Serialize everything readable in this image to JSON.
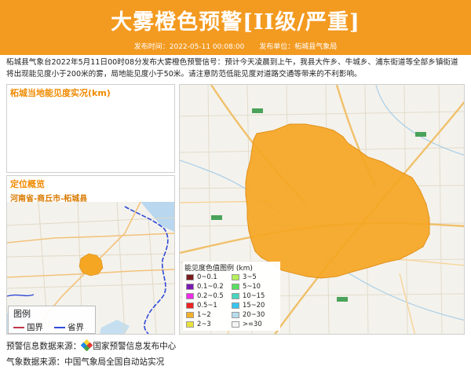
{
  "header": {
    "title": "大雾橙色预警[II级/严重]",
    "publish_time": "发布时间：2022-05-11 00:08:00",
    "publisher": "发布单位：柘城县气象局",
    "bg_color": "#f39a20"
  },
  "summary": "柘城县气象台2022年5月11日00时08分发布大雾橙色预警信号：预计今天凌晨到上午，我县大仵乡、牛城乡、浦东街道等全部乡镇街道将出现能见度小于200米的雾，局地能见度小于50米。请注意防范低能见度对道路交通等带来的不利影响。",
  "visibility_panel": {
    "title": "柘城当地能见度实况(km)"
  },
  "location_panel": {
    "title": "定位概览",
    "subtitle": "河南省-商丘市-柘城县",
    "legend": {
      "title": "图例",
      "items": [
        {
          "label": "国界",
          "color": "#c0384b"
        },
        {
          "label": "省界",
          "color": "#2f4ad8"
        }
      ]
    }
  },
  "visibility_legend": {
    "title": "能见度色值图例 (km)",
    "items": [
      {
        "label": "0~0.1",
        "color": "#7a1b1b"
      },
      {
        "label": "3~5",
        "color": "#b6f05a"
      },
      {
        "label": "0.1~0.2",
        "color": "#7a1ab3"
      },
      {
        "label": "5~10",
        "color": "#58e060"
      },
      {
        "label": "0.2~0.5",
        "color": "#ee2be6"
      },
      {
        "label": "10~15",
        "color": "#48d6c0"
      },
      {
        "label": "0.5~1",
        "color": "#ee2222"
      },
      {
        "label": "15~20",
        "color": "#38c6ee"
      },
      {
        "label": "1~2",
        "color": "#f2b02a"
      },
      {
        "label": "20~30",
        "color": "#b6dcee"
      },
      {
        "label": "2~3",
        "color": "#e8e23a"
      },
      {
        "label": ">=30",
        "color": "#f4f4f4"
      }
    ]
  },
  "sources": {
    "warning_label": "预警信息数据来源：",
    "warning_name": "国家预警信息发布中心",
    "weather": "气象数据来源：中国气象局全国自动站实况"
  },
  "colors": {
    "warning_area": "#f5a623",
    "accent_text": "#f08a00"
  }
}
